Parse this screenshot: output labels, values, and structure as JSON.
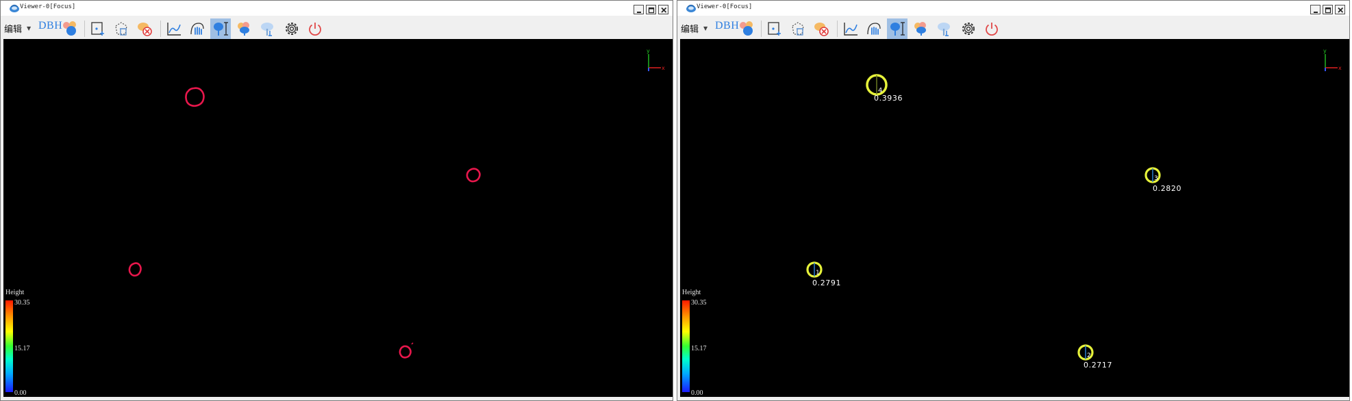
{
  "windows": [
    {
      "title": "Viewer-0[Focus]",
      "menu": {
        "edit_label": "编辑",
        "dbh_label": "DBH"
      },
      "toolbar_icons": [
        "color-points-icon",
        "add-point-icon",
        "delete-polygon-icon",
        "clear-cloud-icon",
        "profile-curve-icon",
        "pan-hand-icon",
        "tree-height-icon",
        "tree-cloud-icon",
        "tree-trunk-icon",
        "settings-gear-icon",
        "power-icon"
      ],
      "active_tool": "tree-height-icon",
      "colorbar": {
        "title": "Height",
        "max": "30.35",
        "mid": "15.17",
        "min": "0.00"
      },
      "axes": {
        "x": "x",
        "y": "y"
      },
      "stems": [
        {
          "id": "stem-1",
          "dbh": ""
        },
        {
          "id": "stem-2",
          "dbh": ""
        },
        {
          "id": "stem-3",
          "dbh": ""
        },
        {
          "id": "stem-4",
          "dbh": ""
        }
      ],
      "stem_color": "#e8174c"
    },
    {
      "title": "Viewer-0[Focus]",
      "menu": {
        "edit_label": "编辑",
        "dbh_label": "DBH"
      },
      "toolbar_icons": [
        "color-points-icon",
        "add-point-icon",
        "delete-polygon-icon",
        "clear-cloud-icon",
        "profile-curve-icon",
        "pan-hand-icon",
        "tree-height-icon",
        "tree-cloud-icon",
        "tree-trunk-icon",
        "settings-gear-icon",
        "power-icon"
      ],
      "active_tool": "tree-height-icon",
      "colorbar": {
        "title": "Height",
        "max": "30.35",
        "mid": "15.17",
        "min": "0.00"
      },
      "axes": {
        "x": "x",
        "y": "y"
      },
      "stems": [
        {
          "id": "stem-1",
          "dbh": "0.3936",
          "marker": "4"
        },
        {
          "id": "stem-2",
          "dbh": "0.2820",
          "marker": "3"
        },
        {
          "id": "stem-3",
          "dbh": "0.2791",
          "marker": "1"
        },
        {
          "id": "stem-4",
          "dbh": "0.2717",
          "marker": "2"
        }
      ],
      "stem_color": "#e6f23a"
    }
  ]
}
